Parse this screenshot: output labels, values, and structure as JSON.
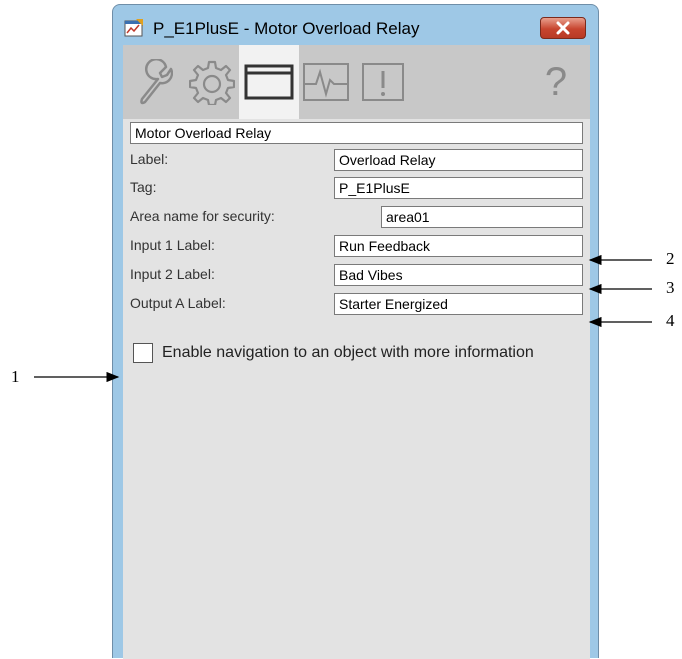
{
  "window": {
    "title": "P_E1PlusE - Motor Overload Relay"
  },
  "toolbar": {
    "tabs": [
      {
        "icon": "wrench-icon",
        "active": false
      },
      {
        "icon": "gear-icon",
        "active": false
      },
      {
        "icon": "window-icon",
        "active": true
      },
      {
        "icon": "trend-icon",
        "active": false
      },
      {
        "icon": "exclamation-icon",
        "active": false
      }
    ],
    "help_label": "?"
  },
  "form": {
    "description": "Motor Overload Relay",
    "fields": [
      {
        "label": "Label:",
        "value": "Overload Relay"
      },
      {
        "label": "Tag:",
        "value": "P_E1PlusE"
      },
      {
        "label": "Area name for security:",
        "value": "area01"
      },
      {
        "label": "Input 1 Label:",
        "value": "Run Feedback"
      },
      {
        "label": "Input 2 Label:",
        "value": "Bad Vibes"
      },
      {
        "label": "Output A Label:",
        "value": "Starter Energized"
      }
    ],
    "enable_navigation": {
      "label": "Enable navigation to an object with more information",
      "checked": false
    }
  },
  "callouts": [
    "1",
    "2",
    "3",
    "4"
  ],
  "colors": {
    "window_frame": "#9ec8e6",
    "toolbar_bg": "#c8c8c8",
    "active_tab_bg": "#f2f2f2",
    "content_bg": "#e3e3e3",
    "close_button": "#c7452f"
  }
}
